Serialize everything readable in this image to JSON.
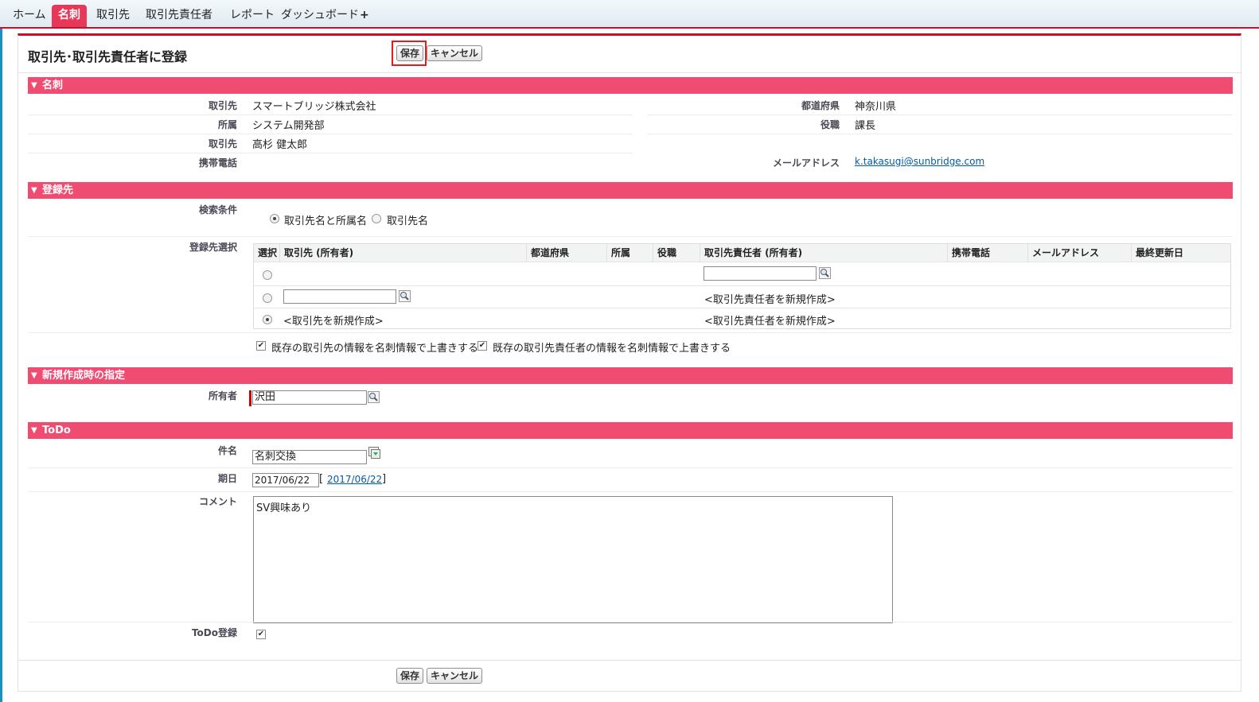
{
  "tabs": [
    {
      "label": "ホーム",
      "active": false
    },
    {
      "label": "名刺",
      "active": true
    },
    {
      "label": "取引先",
      "active": false
    },
    {
      "label": "取引先責任者",
      "active": false
    },
    {
      "label": "レポート",
      "active": false
    },
    {
      "label": "ダッシュボード",
      "active": false
    },
    {
      "label": "+",
      "active": false
    }
  ],
  "page": {
    "title": "取引先･取引先責任者に登録",
    "save_label": "保存",
    "cancel_label": "キャンセル"
  },
  "card": {
    "section_title": "名刺",
    "fields_left": [
      {
        "label": "取引先",
        "value": "スマートブリッジ株式会社"
      },
      {
        "label": "所属",
        "value": "システム開発部"
      },
      {
        "label": "取引先",
        "value": "高杉 健太郎"
      },
      {
        "label": "携帯電話",
        "value": ""
      }
    ],
    "fields_right": [
      {
        "label": "都道府県",
        "value": "神奈川県"
      },
      {
        "label": "役職",
        "value": "課長"
      },
      {
        "label": "メールアドレス",
        "value": "k.takasugi@sunbridge.com"
      }
    ]
  },
  "registration": {
    "section_title": "登録先",
    "search_label": "検索条件",
    "search_options": [
      "取引先名と所属名",
      "取引先名"
    ],
    "search_selected": 0,
    "select_label": "登録先選択",
    "columns": [
      "選択",
      "取引先 (所有者)",
      "都道府県",
      "所属",
      "役職",
      "取引先責任者 (所有者)",
      "携帯電話",
      "メールアドレス",
      "最終更新日"
    ],
    "rows": [
      {
        "account": "",
        "contact": "",
        "selected": false
      },
      {
        "account": "",
        "contact": "<取引先責任者を新規作成>",
        "selected": false
      },
      {
        "account": "<取引先を新規作成>",
        "contact": "<取引先責任者を新規作成>",
        "selected": true
      }
    ],
    "overwrite_account": "既存の取引先の情報を名刺情報で上書きする",
    "overwrite_contact": "既存の取引先責任者の情報を名刺情報で上書きする"
  },
  "newspec": {
    "section_title": "新規作成時の指定",
    "owner_label": "所有者",
    "owner_value": "沢田"
  },
  "todo": {
    "section_title": "ToDo",
    "subject_label": "件名",
    "subject_value": "名刺交換",
    "due_label": "期日",
    "due_value": "2017/06/22",
    "due_today": "2017/06/22",
    "comment_label": "コメント",
    "comment_value": "SV興味あり",
    "register_label": "ToDo登録"
  },
  "colors": {
    "accent": "#f04b71",
    "tab_active": "#e8385a",
    "highlight": "#e31d1d"
  }
}
